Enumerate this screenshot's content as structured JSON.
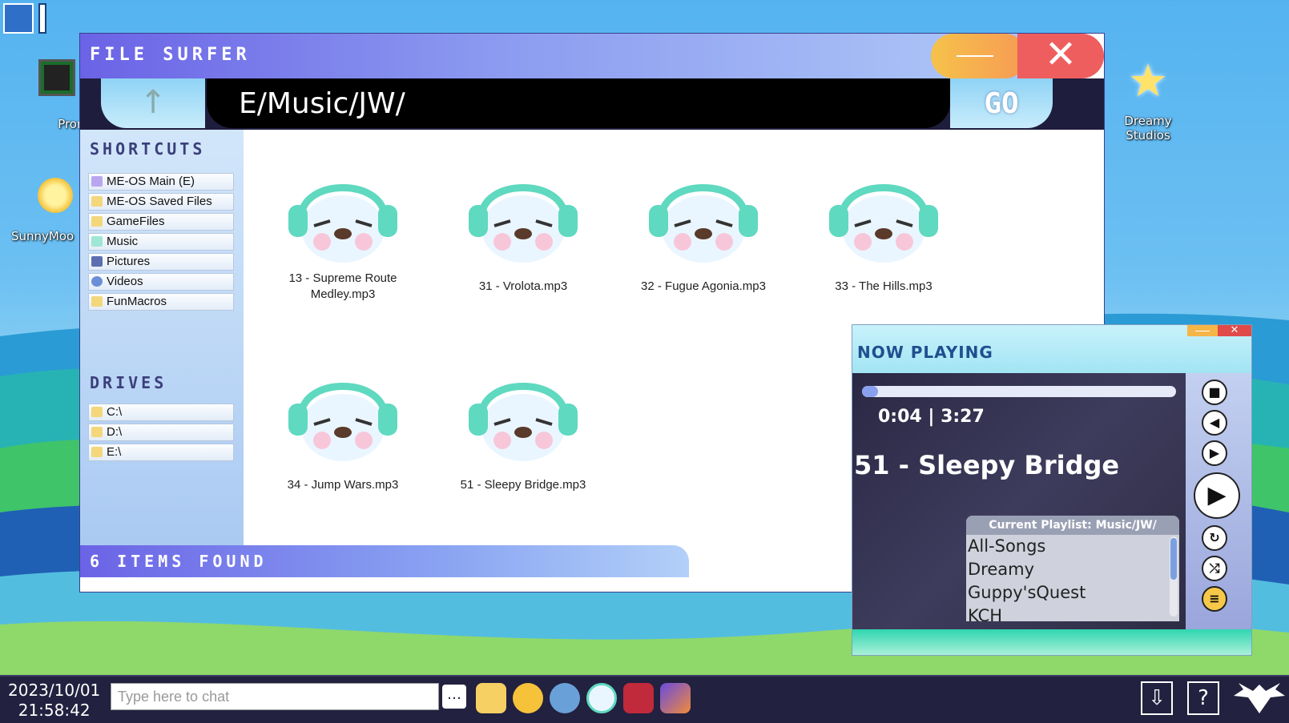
{
  "desktop": {
    "icons": [
      {
        "label": "Prompt"
      },
      {
        "label": "SunnyMoo"
      },
      {
        "label": "Dreamy\nStudios"
      }
    ]
  },
  "file_surfer": {
    "title": "FILE SURFER",
    "close_glyph": "✕",
    "path": "E/Music/JW/",
    "go_label": "GO",
    "up_glyph": "↑",
    "shortcuts_heading": "SHORTCUTS",
    "shortcuts": [
      {
        "label": "ME-OS Main (E)",
        "color": "#b9a6f0"
      },
      {
        "label": "ME-OS Saved Files",
        "color": "#f3d77a"
      },
      {
        "label": "GameFiles",
        "color": "#f3d77a"
      },
      {
        "label": "Music",
        "color": "#9fe6d4"
      },
      {
        "label": "Pictures",
        "color": "#5b6fb0"
      },
      {
        "label": "Videos",
        "color": "#6a8fd6"
      },
      {
        "label": "FunMacros",
        "color": "#f3d77a"
      }
    ],
    "drives_heading": "DRIVES",
    "drives": [
      {
        "label": "C:\\"
      },
      {
        "label": "D:\\"
      },
      {
        "label": "E:\\"
      }
    ],
    "files": [
      {
        "name": "13 - Supreme Route Medley.mp3"
      },
      {
        "name": "31 - Vrolota.mp3"
      },
      {
        "name": "32 - Fugue Agonia.mp3"
      },
      {
        "name": "33 - The Hills.mp3"
      },
      {
        "name": "34 - Jump Wars.mp3"
      },
      {
        "name": "51 - Sleepy Bridge.mp3"
      }
    ],
    "status": "6 ITEMS FOUND"
  },
  "now_playing": {
    "title": "NOW PLAYING",
    "close_glyph": "✕",
    "time": "0:04 | 3:27",
    "progress_fraction": 0.02,
    "song": "51 - Sleepy Bridge",
    "playlist_heading": "Current Playlist: Music/JW/",
    "playlist": [
      "All-Songs",
      "Dreamy",
      "Guppy'sQuest",
      "KCH"
    ],
    "controls": [
      {
        "name": "stop-button",
        "glyph": "■"
      },
      {
        "name": "previous-button",
        "glyph": "◀"
      },
      {
        "name": "next-button",
        "glyph": "▶"
      },
      {
        "name": "play-button",
        "glyph": "▶"
      },
      {
        "name": "repeat-button",
        "glyph": "↻"
      },
      {
        "name": "shuffle-button",
        "glyph": "⤮"
      },
      {
        "name": "playlist-button",
        "glyph": "≡"
      }
    ]
  },
  "taskbar": {
    "date": "2023/10/01",
    "time": "21:58:42",
    "chat_placeholder": "Type here to chat",
    "send_glyph": "…",
    "download_glyph": "⇩",
    "help_glyph": "?"
  }
}
